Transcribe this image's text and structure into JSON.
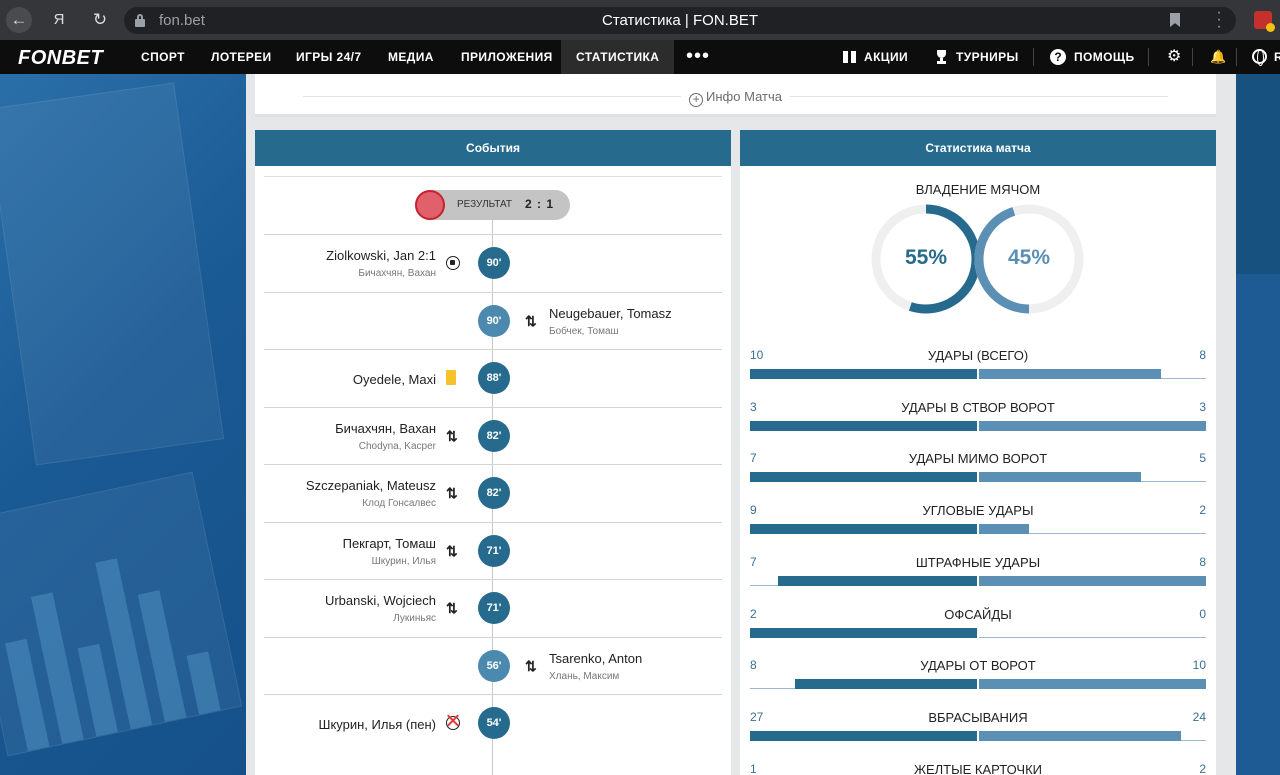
{
  "browser": {
    "url": "fon.bet",
    "title": "Статистика | FON.BET",
    "back_glyph": "←",
    "yandex_glyph": "Я",
    "reload_glyph": "↻",
    "kebab_glyph": "⋮"
  },
  "topnav": {
    "logo": "FONBET",
    "items": [
      "СПОРТ",
      "ЛОТЕРЕИ",
      "ИГРЫ 24/7",
      "МЕДИА",
      "ПРИЛОЖЕНИЯ",
      "СТАТИСТИКА"
    ],
    "active": "СТАТИСТИКА",
    "more": "•••",
    "promo": "АКЦИИ",
    "tournaments": "ТУРНИРЫ",
    "help": "ПОМОЩЬ",
    "help_glyph": "?",
    "gear_glyph": "⚙",
    "bell_glyph": "🔔",
    "lang": "R"
  },
  "info_match": {
    "plus": "+",
    "label": "Инфо Матча"
  },
  "events_panel": {
    "title": "События",
    "result_label": "РЕЗУЛЬТАТ",
    "result_score": "2 : 1",
    "events": [
      {
        "side": "home",
        "minute": "90'",
        "name": "Ziolkowski, Jan  2:1",
        "sub": "Бичахчян, Вахан",
        "icon": "goal-icon"
      },
      {
        "side": "away",
        "minute": "90'",
        "name": "Neugebauer, Tomasz",
        "sub": "Бобчек, Томаш",
        "icon": "substitution-icon"
      },
      {
        "side": "home",
        "minute": "88'",
        "name": "Oyedele, Maxi",
        "sub": "",
        "icon": "yellow-card-icon"
      },
      {
        "side": "home",
        "minute": "82'",
        "name": "Бичахчян, Вахан",
        "sub": "Chodyna, Kacper",
        "icon": "substitution-icon"
      },
      {
        "side": "home",
        "minute": "82'",
        "name": "Szczepaniak, Mateusz",
        "sub": "Клод Гонсалвес",
        "icon": "substitution-icon"
      },
      {
        "side": "home",
        "minute": "71'",
        "name": "Пекгарт, Томаш",
        "sub": "Шкурин, Илья",
        "icon": "substitution-icon"
      },
      {
        "side": "home",
        "minute": "71'",
        "name": "Urbanski, Wojciech",
        "sub": "Лукиньяс",
        "icon": "substitution-icon"
      },
      {
        "side": "away",
        "minute": "56'",
        "name": "Tsarenko, Anton",
        "sub": "Хлань, Максим",
        "icon": "substitution-icon"
      },
      {
        "side": "home",
        "minute": "54'",
        "name": "Шкурин, Илья  (пен)",
        "sub": "",
        "icon": "missed-penalty-icon"
      }
    ],
    "sub_glyph": "⇅"
  },
  "stats_panel": {
    "title": "Статистика матча",
    "possession_title": "ВЛАДЕНИЕ МЯЧОМ",
    "possession": {
      "home": 55,
      "away": 45,
      "home_label": "55%",
      "away_label": "45%"
    },
    "colors": {
      "home": "#266b8e",
      "away": "#5b8fb3",
      "track": "#efefef"
    },
    "rows": [
      {
        "label": "УДАРЫ (ВСЕГО)",
        "home": 10,
        "away": 8
      },
      {
        "label": "УДАРЫ В СТВОР ВОРОТ",
        "home": 3,
        "away": 3
      },
      {
        "label": "УДАРЫ МИМО ВОРОТ",
        "home": 7,
        "away": 5
      },
      {
        "label": "УГЛОВЫЕ УДАРЫ",
        "home": 9,
        "away": 2
      },
      {
        "label": "ШТРАФНЫЕ УДАРЫ",
        "home": 7,
        "away": 8
      },
      {
        "label": "ОФСАЙДЫ",
        "home": 2,
        "away": 0
      },
      {
        "label": "УДАРЫ ОТ ВОРОТ",
        "home": 8,
        "away": 10
      },
      {
        "label": "ВБРАСЫВАНИЯ",
        "home": 27,
        "away": 24
      },
      {
        "label": "ЖЕЛТЫЕ КАРТОЧКИ",
        "home": 1,
        "away": 2
      }
    ]
  }
}
